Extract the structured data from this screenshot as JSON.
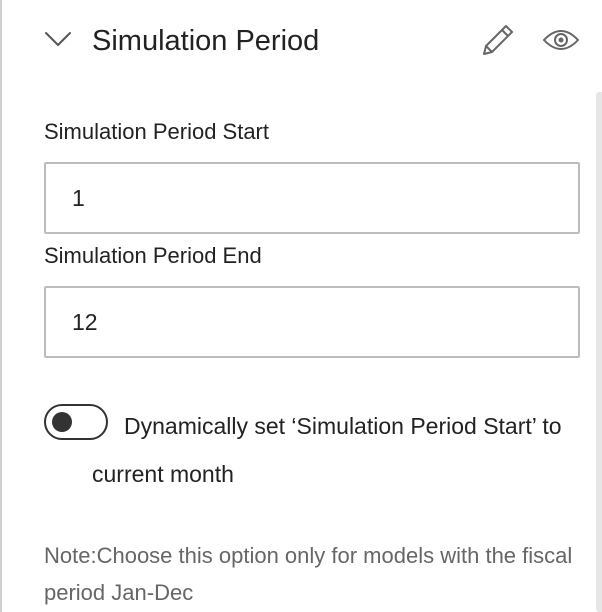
{
  "section": {
    "title": "Simulation Period",
    "icons": {
      "collapse": "chevron-down-icon",
      "edit": "pencil-icon",
      "visibility": "eye-icon"
    }
  },
  "fields": {
    "start": {
      "label": "Simulation Period Start",
      "value": "1"
    },
    "end": {
      "label": "Simulation Period End",
      "value": "12"
    }
  },
  "toggle": {
    "label": "Dynamically set ‘Simulation Period Start’ to current month",
    "state": "off"
  },
  "note": "Note:Choose this option only for models with the fiscal period Jan-Dec",
  "colors": {
    "text": "#222222",
    "note_text": "#666666",
    "input_border": "#bdbdbd",
    "toggle_dark": "#333333",
    "icon_gray": "#666666"
  }
}
